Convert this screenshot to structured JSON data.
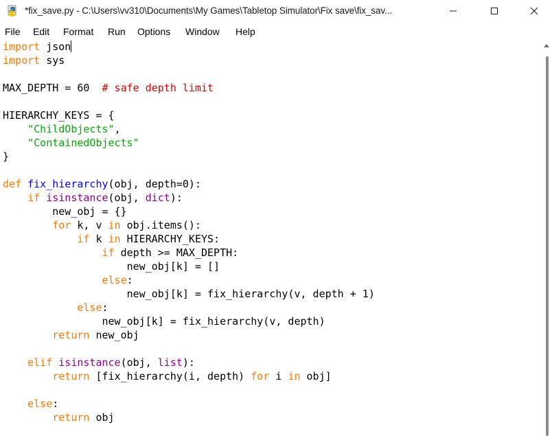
{
  "window": {
    "title": "*fix_save.py - C:\\Users\\vv310\\Documents\\My Games\\Tabletop Simulator\\Fix save\\fix_sav...",
    "app_icon": "python-idle-icon",
    "controls": {
      "minimize": "minimize-icon",
      "maximize": "maximize-icon",
      "close": "close-icon"
    }
  },
  "menu": {
    "items": [
      "File",
      "Edit",
      "Format",
      "Run",
      "Options",
      "Window",
      "Help"
    ]
  },
  "colors": {
    "keyword": "#ff7700",
    "builtin": "#900090",
    "definition": "#0000ff",
    "string": "#00aa00",
    "comment": "#dd0000",
    "text": "#000000"
  },
  "code": {
    "lines": [
      [
        [
          "kw",
          "import"
        ],
        [
          "",
          " json"
        ]
      ],
      [
        [
          "kw",
          "import"
        ],
        [
          "",
          " sys"
        ]
      ],
      [],
      [
        [
          "",
          "MAX_DEPTH = 60  "
        ],
        [
          "cm",
          "# safe depth limit"
        ]
      ],
      [],
      [
        [
          "",
          "HIERARCHY_KEYS = {"
        ]
      ],
      [
        [
          "",
          "    "
        ],
        [
          "str",
          "\"ChildObjects\""
        ],
        [
          "",
          ","
        ]
      ],
      [
        [
          "",
          "    "
        ],
        [
          "str",
          "\"ContainedObjects\""
        ]
      ],
      [
        [
          "",
          "}"
        ]
      ],
      [],
      [
        [
          "kw",
          "def"
        ],
        [
          "",
          " "
        ],
        [
          "fn",
          "fix_hierarchy"
        ],
        [
          "",
          "(obj, depth=0):"
        ]
      ],
      [
        [
          "",
          "    "
        ],
        [
          "kw",
          "if"
        ],
        [
          "",
          " "
        ],
        [
          "bi",
          "isinstance"
        ],
        [
          "",
          "(obj, "
        ],
        [
          "bi",
          "dict"
        ],
        [
          "",
          "):"
        ]
      ],
      [
        [
          "",
          "        new_obj = {}"
        ]
      ],
      [
        [
          "",
          "        "
        ],
        [
          "kw",
          "for"
        ],
        [
          "",
          " k, v "
        ],
        [
          "kw",
          "in"
        ],
        [
          "",
          " obj.items():"
        ]
      ],
      [
        [
          "",
          "            "
        ],
        [
          "kw",
          "if"
        ],
        [
          "",
          " k "
        ],
        [
          "kw",
          "in"
        ],
        [
          "",
          " HIERARCHY_KEYS:"
        ]
      ],
      [
        [
          "",
          "                "
        ],
        [
          "kw",
          "if"
        ],
        [
          "",
          " depth >= MAX_DEPTH:"
        ]
      ],
      [
        [
          "",
          "                    new_obj[k] = []"
        ]
      ],
      [
        [
          "",
          "                "
        ],
        [
          "kw",
          "else"
        ],
        [
          "",
          ":"
        ]
      ],
      [
        [
          "",
          "                    new_obj[k] = fix_hierarchy(v, depth + 1)"
        ]
      ],
      [
        [
          "",
          "            "
        ],
        [
          "kw",
          "else"
        ],
        [
          "",
          ":"
        ]
      ],
      [
        [
          "",
          "                new_obj[k] = fix_hierarchy(v, depth)"
        ]
      ],
      [
        [
          "",
          "        "
        ],
        [
          "kw",
          "return"
        ],
        [
          "",
          " new_obj"
        ]
      ],
      [],
      [
        [
          "",
          "    "
        ],
        [
          "kw",
          "elif"
        ],
        [
          "",
          " "
        ],
        [
          "bi",
          "isinstance"
        ],
        [
          "",
          "(obj, "
        ],
        [
          "bi",
          "list"
        ],
        [
          "",
          "):"
        ]
      ],
      [
        [
          "",
          "        "
        ],
        [
          "kw",
          "return"
        ],
        [
          "",
          " [fix_hierarchy(i, depth) "
        ],
        [
          "kw",
          "for"
        ],
        [
          "",
          " i "
        ],
        [
          "kw",
          "in"
        ],
        [
          "",
          " obj]"
        ]
      ],
      [],
      [
        [
          "",
          "    "
        ],
        [
          "kw",
          "else"
        ],
        [
          "",
          ":"
        ]
      ],
      [
        [
          "",
          "        "
        ],
        [
          "kw",
          "return"
        ],
        [
          "",
          " obj"
        ]
      ]
    ]
  }
}
